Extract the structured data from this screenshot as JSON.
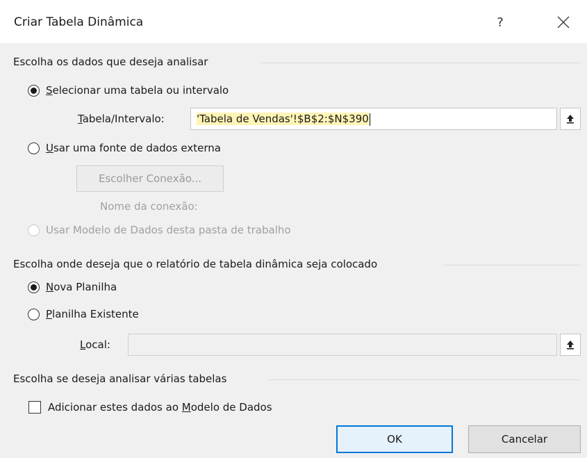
{
  "dialog": {
    "title": "Criar Tabela Dinâmica",
    "help_label": "?"
  },
  "section_data": {
    "header": "Escolha os dados que deseja analisar",
    "option_table": {
      "accel": "S",
      "rest": "elecionar uma tabela ou intervalo",
      "checked": true
    },
    "range_label": {
      "accel": "T",
      "rest": "abela/Intervalo:"
    },
    "range_value": "'Tabela de Vendas'!$B$2:$N$390",
    "option_external": {
      "accel": "U",
      "rest": "sar uma fonte de dados externa",
      "checked": false
    },
    "choose_connection_label": "Escolher Conexão...",
    "connection_name_label": "Nome da conexão:",
    "option_data_model": {
      "label": "Usar Modelo de Dados desta pasta de trabalho",
      "checked": false
    }
  },
  "section_location": {
    "header": "Escolha onde deseja que o relatório de tabela dinâmica seja colocado",
    "option_new_sheet": {
      "accel": "N",
      "rest": "ova Planilha",
      "checked": true
    },
    "option_existing_sheet": {
      "accel": "P",
      "rest": "lanilha Existente",
      "checked": false
    },
    "local_label": {
      "accel": "L",
      "rest": "ocal:"
    },
    "local_value": ""
  },
  "section_multi": {
    "header": "Escolha se deseja analisar várias tabelas",
    "checkbox_pre": "Adicionar estes dados ao ",
    "checkbox_accel": "M",
    "checkbox_post": "odelo de Dados",
    "checked": false
  },
  "buttons": {
    "ok_label": "OK",
    "cancel_label": "Cancelar"
  }
}
